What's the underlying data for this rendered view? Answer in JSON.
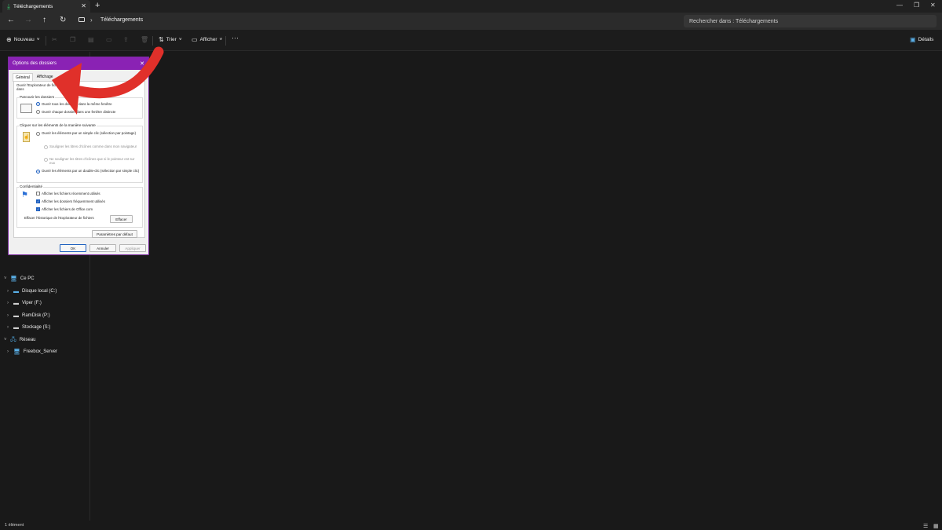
{
  "titlebar": {
    "tab_title": "Téléchargements",
    "new_tab": "+",
    "minimize": "—",
    "restore": "❐",
    "close": "✕"
  },
  "addressbar": {
    "breadcrumb": "Téléchargements",
    "search_placeholder": "Rechercher dans : Téléchargements"
  },
  "toolbar": {
    "new_label": "Nouveau",
    "sort_label": "Trier",
    "view_label": "Afficher",
    "more_label": "···",
    "details_label": "Détails"
  },
  "sidebar": {
    "items": [
      {
        "label": "Ce PC",
        "icon": "computer-icon",
        "expanded": true
      },
      {
        "label": "Disque local (C:)",
        "icon": "drive-icon"
      },
      {
        "label": "Viper (F:)",
        "icon": "drive-icon"
      },
      {
        "label": "RamDisk (P:)",
        "icon": "drive-icon"
      },
      {
        "label": "Stockage (S:)",
        "icon": "drive-icon"
      },
      {
        "label": "Réseau",
        "icon": "network-icon",
        "expanded": true
      },
      {
        "label": "Freebox_Server",
        "icon": "computer-icon"
      }
    ]
  },
  "status": {
    "count": "1 élément"
  },
  "dialog": {
    "title": "Options des dossiers",
    "tabs": [
      "Général",
      "Affichage"
    ],
    "open_explorer_label": "Ouvrir l'Explorateur de fichiers dans",
    "browse": {
      "label": "Parcourir les dossiers",
      "option1": "Ouvrir tous les dossiers dans la même fenêtre",
      "option2": "Ouvrir chaque dossier dans une fenêtre distincte"
    },
    "click": {
      "label": "Cliquer sur les éléments de la manière suivante",
      "single": "Ouvrir les éléments par un simple clic (sélection par pointage)",
      "sub1": "Souligner les titres d'icônes comme dans mon navigateur",
      "sub2": "Ne souligner les titres d'icônes que si le pointeur est sur eux",
      "double": "Ouvrir les éléments par un double-clic (sélection par simple clic)"
    },
    "privacy": {
      "label": "Confidentialité",
      "c1": "Afficher les fichiers récemment utilisés",
      "c2": "Afficher les dossiers fréquemment utilisés",
      "c3": "Afficher les fichiers de Office.com",
      "clear_label": "Effacer l'historique de l'Explorateur de fichiers",
      "clear_button": "Effacer"
    },
    "defaults_button": "Paramètres par défaut",
    "ok": "OK",
    "cancel": "Annuler",
    "apply": "Appliquer"
  },
  "colors": {
    "dialog_titlebar": "#8a22b4",
    "annotation_arrow": "#e0302a",
    "accent": "#1e5fbf"
  }
}
